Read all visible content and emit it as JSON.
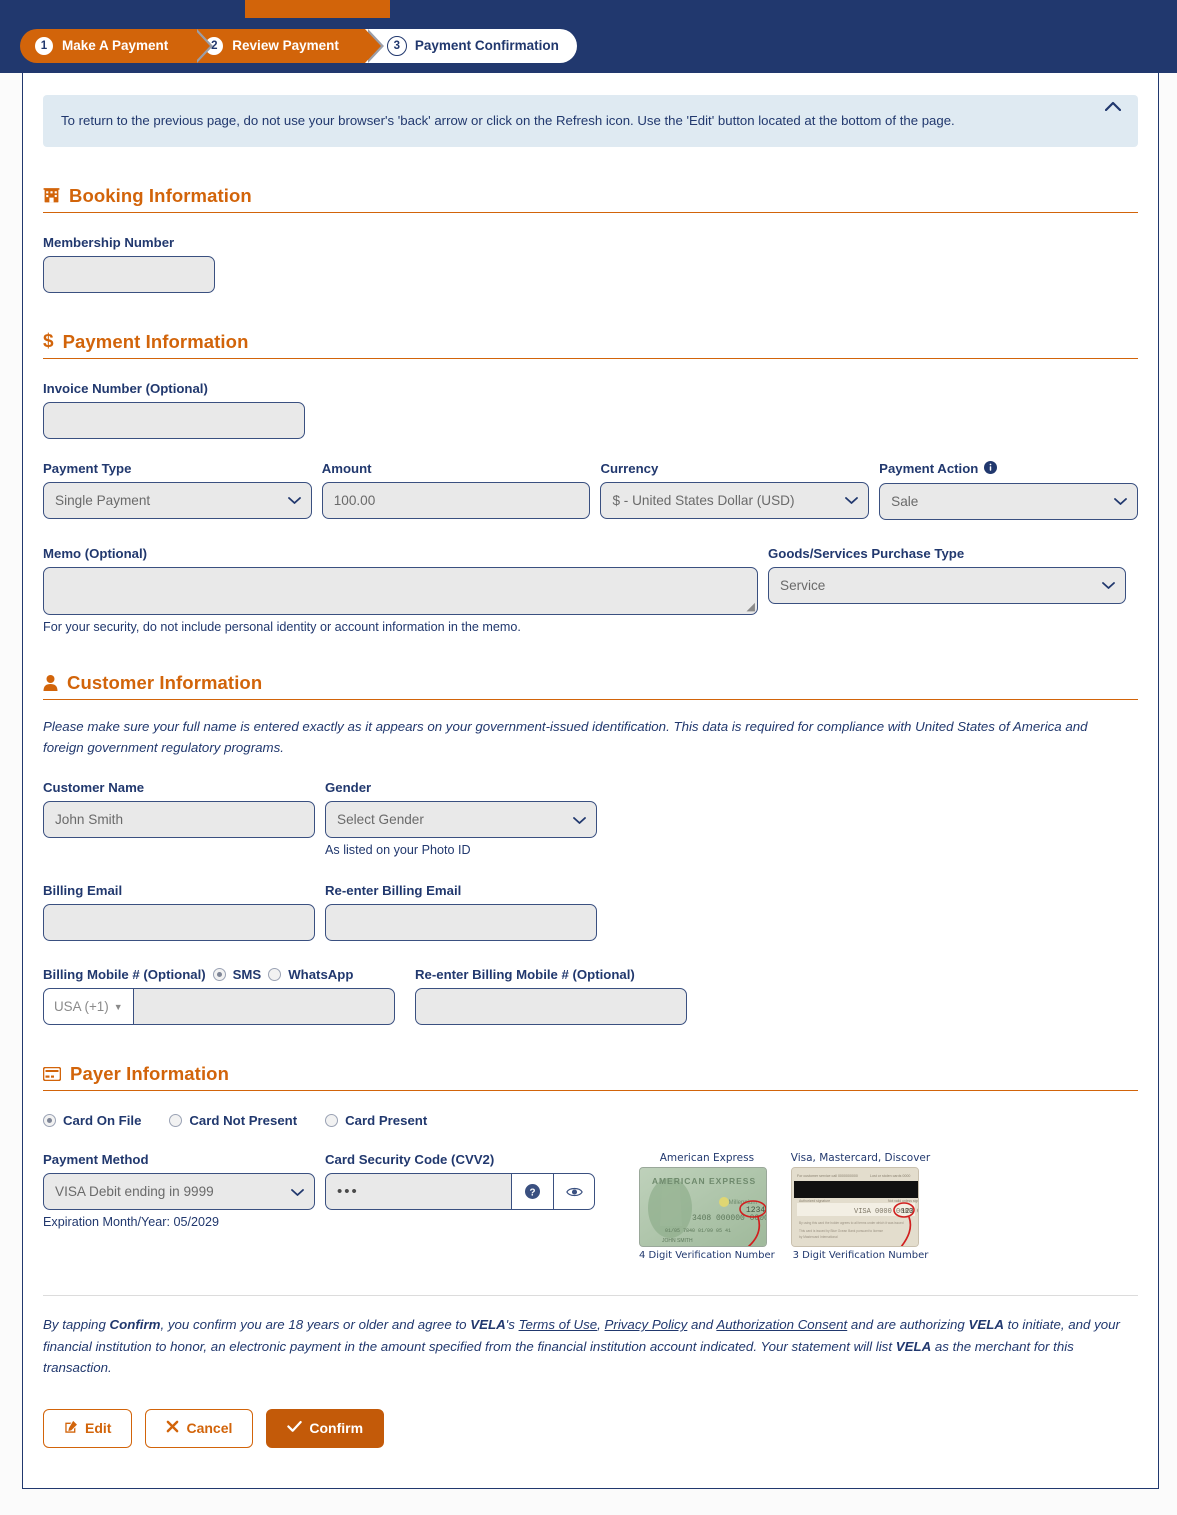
{
  "topnav": {
    "active_label": ""
  },
  "breadcrumb": {
    "steps": [
      {
        "num": "1",
        "label": "Make A Payment",
        "state": "done"
      },
      {
        "num": "2",
        "label": "Review Payment",
        "state": "done"
      },
      {
        "num": "3",
        "label": "Payment Confirmation",
        "state": "current"
      }
    ]
  },
  "banner": {
    "text": "To return to the previous page, do not use your browser's 'back' arrow or click on the Refresh icon. Use the 'Edit' button located at the bottom of the page.",
    "collapse_icon": "chevron-up-icon"
  },
  "booking": {
    "section_title": "Booking Information",
    "section_icon": "building-icon",
    "membership_label": "Membership Number",
    "membership_value": ""
  },
  "payment": {
    "section_title": "Payment Information",
    "section_icon": "dollar-icon",
    "invoice_label": "Invoice Number (Optional)",
    "invoice_value": "",
    "payment_type_label": "Payment Type",
    "payment_type_value": "Single Payment",
    "amount_label": "Amount",
    "amount_value": "100.00",
    "currency_label": "Currency",
    "currency_value": "$ - United States Dollar (USD)",
    "payment_action_label": "Payment Action",
    "payment_action_info_icon": "info-icon",
    "payment_action_value": "Sale",
    "memo_label": "Memo (Optional)",
    "memo_value": "",
    "memo_hint": "For your security, do not include personal identity or account information in the memo.",
    "goods_label": "Goods/Services Purchase Type",
    "goods_value": "Service"
  },
  "customer": {
    "section_title": "Customer Information",
    "section_icon": "person-icon",
    "note": "Please make sure your full name is entered exactly as it appears on your government-issued identification. This data is required for compliance with United States of America and foreign government regulatory programs.",
    "name_label": "Customer Name",
    "name_value": "John Smith",
    "gender_label": "Gender",
    "gender_value": "Select Gender",
    "gender_hint": "As listed on your Photo ID",
    "email_label": "Billing Email",
    "email_value": "",
    "email_confirm_label": "Re-enter Billing Email",
    "email_confirm_value": "",
    "mobile_label": "Billing Mobile # (Optional)",
    "sms_label": "SMS",
    "whatsapp_label": "WhatsApp",
    "country_code": "USA (+1)",
    "mobile_value": "",
    "mobile_confirm_label": "Re-enter Billing Mobile # (Optional)",
    "mobile_confirm_value": ""
  },
  "payer": {
    "section_title": "Payer Information",
    "section_icon": "credit-card-icon",
    "options": [
      {
        "label": "Card On File",
        "selected": true
      },
      {
        "label": "Card Not Present",
        "selected": false
      },
      {
        "label": "Card Present",
        "selected": false
      }
    ],
    "method_label": "Payment Method",
    "method_value": "VISA Debit ending in 9999",
    "expiration_text": "Expiration Month/Year: 05/2029",
    "cvv_label": "Card Security Code (CVV2)",
    "cvv_value": "•••",
    "cvv_help_icon": "question-circle-icon",
    "cvv_eye_icon": "eye-icon",
    "amex_caption": "American Express",
    "amex_footer": "4 Digit Verification Number",
    "visa_caption": "Visa, Mastercard, Discover",
    "visa_footer": "3 Digit Verification Number",
    "amex_card_brand": "AMERICAN EXPRESS",
    "amex_card_number": "3408 000000 00000",
    "visa_card_number": "VISA 0000 0000 0000  123"
  },
  "legal": {
    "p1": "By tapping ",
    "confirm_word": "Confirm",
    "p2": ", you confirm you are 18 years or older and agree to ",
    "brand1": "VELA",
    "p3": "'s ",
    "link1": "Terms of Use",
    "p4": ", ",
    "link2": "Privacy Policy",
    "p5": " and ",
    "link3": "Authorization Consent",
    "p6": " and are authorizing ",
    "brand2": "VELA",
    "p7": " to initiate, and your financial institution to honor, an electronic payment in the amount specified from the financial institution account indicated. Your statement will list ",
    "brand3": "VELA",
    "p8": " as the merchant for this transaction."
  },
  "buttons": {
    "edit": "Edit",
    "cancel": "Cancel",
    "confirm": "Confirm",
    "edit_icon": "pencil-square-icon",
    "cancel_icon": "x-mark-icon",
    "confirm_icon": "check-icon"
  },
  "colors": {
    "navy": "#21386e",
    "orange": "#d2640a",
    "orange_dark": "#c35a09",
    "field_bg": "#e9e9e9",
    "banner_bg": "#dfeaf2"
  }
}
